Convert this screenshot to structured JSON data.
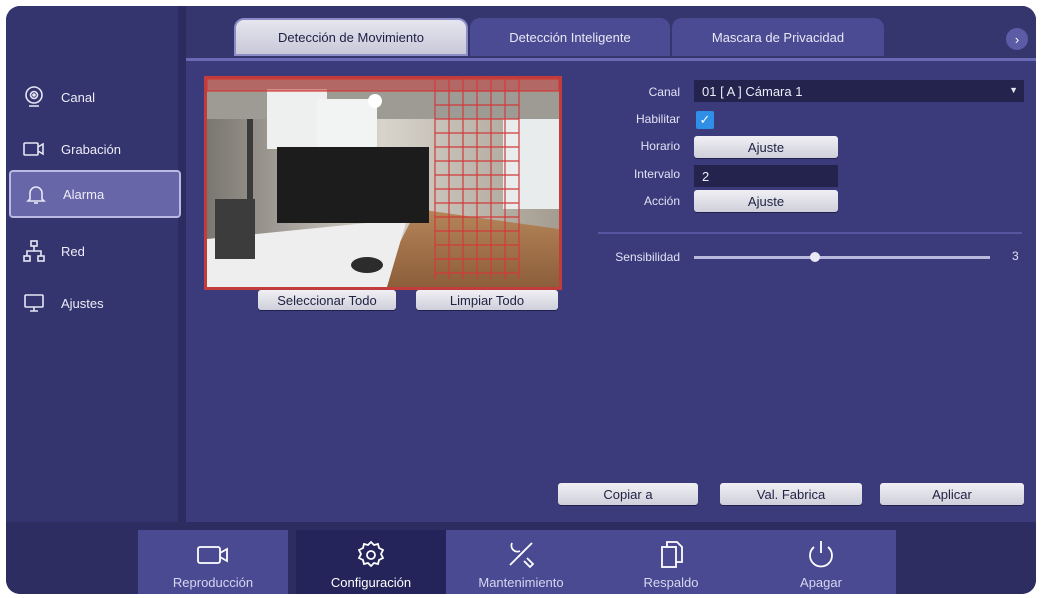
{
  "tabs": [
    {
      "label": "Detección de Movimiento",
      "active": true
    },
    {
      "label": "Detección Inteligente",
      "active": false
    },
    {
      "label": "Mascara de Privacidad",
      "active": false
    }
  ],
  "tab_arrow_icon": "chevron-right-icon",
  "sidebar": {
    "items": [
      {
        "label": "Canal",
        "icon": "webcam-icon"
      },
      {
        "label": "Grabación",
        "icon": "video-camera-icon"
      },
      {
        "label": "Alarma",
        "icon": "bell-icon",
        "active": true
      },
      {
        "label": "Red",
        "icon": "network-icon"
      },
      {
        "label": "Ajustes",
        "icon": "monitor-icon"
      }
    ]
  },
  "preview": {
    "select_all_label": "Seleccionar Todo",
    "clear_all_label": "Limpiar Todo"
  },
  "form": {
    "canal_label": "Canal",
    "canal_value": "01 [ A ] Cámara 1",
    "habilitar_label": "Habilitar",
    "habilitar_checked": true,
    "horario_label": "Horario",
    "horario_button": "Ajuste",
    "intervalo_label": "Intervalo",
    "intervalo_value": "2",
    "accion_label": "Acción",
    "accion_button": "Ajuste",
    "sensibilidad_label": "Sensibilidad",
    "sensibilidad_value": "3"
  },
  "actions": {
    "copy_label": "Copiar a",
    "factory_label": "Val. Fabrica",
    "apply_label": "Aplicar"
  },
  "bottom_nav": [
    {
      "label": "Reproducción",
      "icon": "video-camera-icon"
    },
    {
      "label": "Configuración",
      "icon": "gear-icon",
      "active": true
    },
    {
      "label": "Mantenimiento",
      "icon": "tools-icon"
    },
    {
      "label": "Respaldo",
      "icon": "copy-icon"
    },
    {
      "label": "Apagar",
      "icon": "power-icon"
    }
  ],
  "colors": {
    "background": "#3b3b7c",
    "sidebar": "#34346f",
    "accent_check": "#2f8fe6",
    "motion_grid": "#d23a3a"
  }
}
